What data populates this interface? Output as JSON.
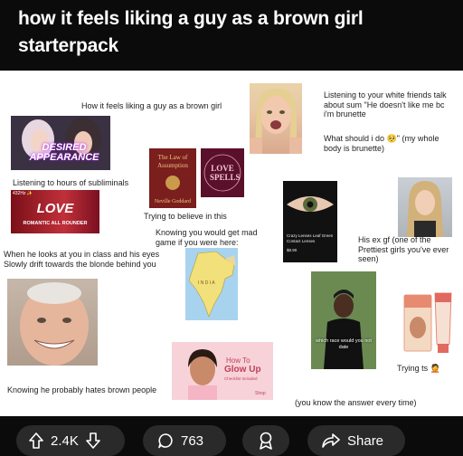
{
  "post": {
    "title": "how it feels liking a guy as a brown girl starterpack"
  },
  "captions": {
    "c1": "How it feels liking a guy as a brown girl",
    "c2": "Listening to your white friends talk about sum \"He doesn't like me bc i'm brunette",
    "c2b": "What should i do 🥺\" (my whole body is brunette)",
    "c3": "Listening to hours of subliminals",
    "c4": "Trying to believe  in this",
    "c5": "Knowing you would get mad game if you were here:",
    "c6": "When he looks at you in class and his eyes Slowly drift towards the blonde behind you",
    "c7": "His ex gf (one of the Prettiest girls you've ever seen)",
    "c8": "Trying ts 🤦",
    "c9": "Knowing he probably hates brown people",
    "c10": "(you know the answer every time)"
  },
  "images": {
    "desired_text": "DESIRED APPEARANCE",
    "love_top": "432Hz ✨",
    "love_text": "LOVE",
    "love_sub": "ROMANTIC ALL ROUNDER",
    "book1_title": "The Law of Assumption",
    "book1_author": "Neville Goddard",
    "book2_title": "LOVE SPELLS",
    "lens_text": "Crazy Lenses Leaf Green Contact Lenses",
    "lens_price": "$8.90",
    "map_label": "I N D I A",
    "glow_line1": "How To",
    "glow_line2": "Glow Up",
    "glow_line3": "Checklist Included",
    "glow_brand": "Shop",
    "meme_text": "which race would you not date"
  },
  "actions": {
    "upvotes": "2.4K",
    "comments": "763",
    "share": "Share"
  },
  "colors": {
    "bg": "#0b0b0b",
    "pill": "#2a2a2a",
    "text": "#ffffff"
  }
}
